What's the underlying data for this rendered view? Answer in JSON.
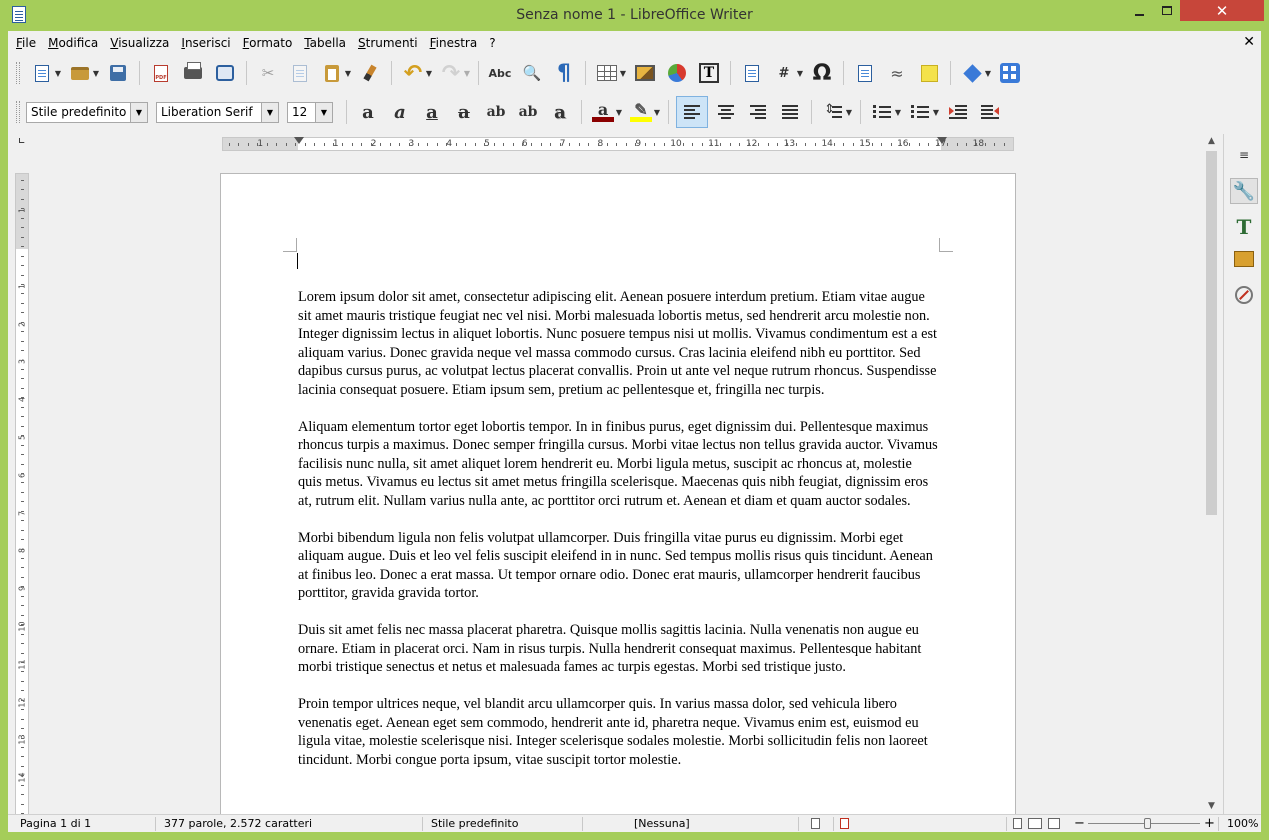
{
  "window": {
    "title": "Senza nome 1 - LibreOffice Writer",
    "close_glyph": "✕"
  },
  "menubar": {
    "items": [
      "File",
      "Modifica",
      "Visualizza",
      "Inserisci",
      "Formato",
      "Tabella",
      "Strumenti",
      "Finestra",
      "?"
    ],
    "doc_close": "✕"
  },
  "toolbar_standard": {
    "icons": [
      "new-document-icon",
      "open-folder-icon",
      "save-icon",
      "export-pdf-icon",
      "print-icon",
      "print-preview-icon",
      "cut-icon",
      "copy-icon",
      "paste-icon",
      "clone-formatting-icon",
      "undo-icon",
      "redo-icon",
      "spelling-icon",
      "find-replace-icon",
      "formatting-marks-icon",
      "insert-table-icon",
      "insert-image-icon",
      "insert-chart-icon",
      "insert-textbox-icon",
      "page-break-icon",
      "insert-field-icon",
      "special-character-icon",
      "hyperlink-icon",
      "footnote-icon",
      "comment-icon",
      "basic-shapes-icon",
      "draw-functions-icon"
    ],
    "glyphs": {
      "undo": "↶",
      "redo": "↷",
      "spell": "Abc",
      "pilcrow": "¶",
      "omega": "Ω",
      "cut": "✂",
      "find": "🔍",
      "field": "#",
      "hyperlink": "≈"
    }
  },
  "toolbar_format": {
    "paragraph_style": "Stile predefinito",
    "font_name": "Liberation Serif",
    "font_size": "12",
    "style_glyphs": [
      "a",
      "a",
      "a",
      "a",
      "ab",
      "ab",
      "a"
    ],
    "font_color": "#8b0000",
    "highlight_color": "#ffff00",
    "active_alignment": "left"
  },
  "ruler": {
    "h_numbers": [
      "1",
      "1",
      "2",
      "3",
      "4",
      "5",
      "6",
      "7",
      "8",
      "9",
      "10",
      "11",
      "12",
      "13",
      "14",
      "15",
      "16",
      "17",
      "18"
    ],
    "v_numbers": [
      "1",
      "1",
      "2",
      "3",
      "4",
      "5",
      "6",
      "7",
      "8",
      "9",
      "10",
      "11",
      "12",
      "13",
      "14"
    ]
  },
  "document": {
    "paragraphs": [
      "Lorem ipsum dolor sit amet, consectetur adipiscing elit. Aenean posuere interdum pretium. Etiam vitae augue sit amet mauris tristique feugiat nec vel nisi. Morbi malesuada lobortis metus, sed hendrerit arcu molestie non. Integer dignissim lectus in aliquet lobortis. Nunc posuere tempus nisi ut mollis. Vivamus condimentum est a est aliquam varius. Donec gravida neque vel massa commodo cursus. Cras lacinia eleifend nibh eu porttitor. Sed dapibus cursus purus, ac volutpat lectus placerat convallis. Proin ut ante vel neque rutrum rhoncus. Suspendisse lacinia consequat posuere. Etiam ipsum sem, pretium ac pellentesque et, fringilla nec turpis.",
      "Aliquam elementum tortor eget lobortis tempor. In in finibus purus, eget dignissim dui. Pellentesque maximus rhoncus turpis a maximus. Donec semper fringilla cursus. Morbi vitae lectus non tellus gravida auctor. Vivamus facilisis nunc nulla, sit amet aliquet lorem hendrerit eu. Morbi ligula metus, suscipit ac rhoncus at, molestie quis metus. Vivamus eu lectus sit amet metus fringilla scelerisque. Maecenas quis nibh feugiat, dignissim eros at, rutrum elit. Nullam varius nulla ante, ac porttitor orci rutrum et. Aenean et diam et quam auctor sodales.",
      "Morbi bibendum ligula non felis volutpat ullamcorper. Duis fringilla vitae purus eu dignissim. Morbi eget aliquam augue. Duis et leo vel felis suscipit eleifend in in nunc. Sed tempus mollis risus quis tincidunt. Aenean at finibus leo. Donec a erat massa. Ut tempor ornare odio. Donec erat mauris, ullamcorper hendrerit faucibus porttitor, gravida gravida tortor.",
      "Duis sit amet felis nec massa placerat pharetra. Quisque mollis sagittis lacinia. Nulla venenatis non augue eu ornare. Etiam in placerat orci. Nam in risus turpis. Nulla hendrerit consequat maximus. Pellentesque habitant morbi tristique senectus et netus et malesuada fames ac turpis egestas. Morbi sed tristique justo.",
      "Proin tempor ultrices neque, vel blandit arcu ullamcorper quis. In varius massa dolor, sed vehicula libero venenatis eget. Aenean eget sem commodo, hendrerit ante id, pharetra neque. Vivamus enim est, euismod eu ligula vitae, molestie scelerisque nisi. Integer scelerisque sodales molestie. Morbi sollicitudin felis non laoreet tincidunt. Morbi congue porta ipsum, vitae suscipit tortor molestie."
    ]
  },
  "statusbar": {
    "page": "Pagina 1 di 1",
    "words": "377 parole, 2.572 caratteri",
    "style": "Stile predefinito",
    "language": "[Nessuna]",
    "zoom": "100%",
    "zoom_minus": "−",
    "zoom_plus": "+"
  },
  "colors": {
    "titlebar": "#a5cd5a",
    "close_button": "#c7463a",
    "chrome": "#f0f0f0"
  }
}
